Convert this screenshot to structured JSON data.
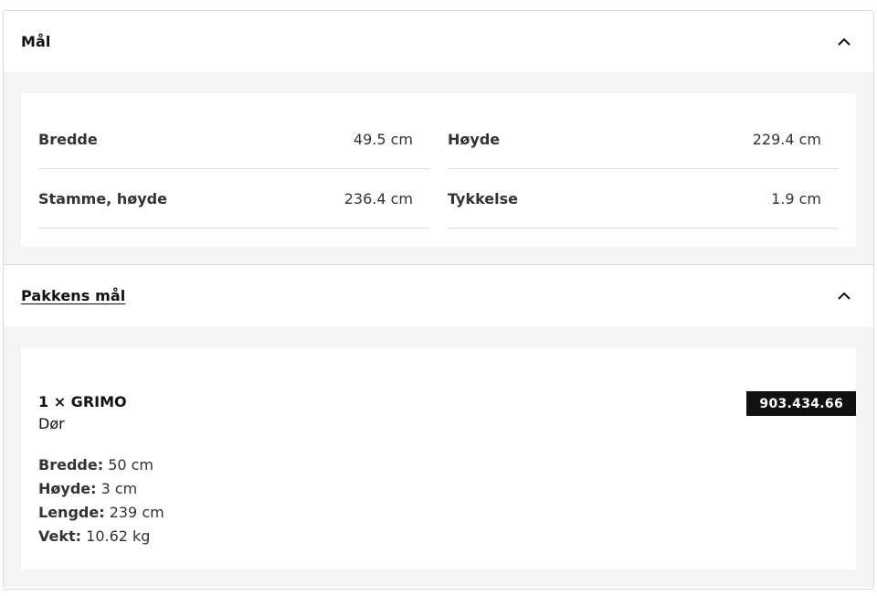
{
  "dimensions": {
    "title": "Mål",
    "rows_left": [
      {
        "label": "Bredde",
        "value": "49.5 cm"
      },
      {
        "label": "Stamme, høyde",
        "value": "236.4 cm"
      }
    ],
    "rows_right": [
      {
        "label": "Høyde",
        "value": "229.4 cm"
      },
      {
        "label": "Tykkelse",
        "value": "1.9 cm"
      }
    ]
  },
  "package": {
    "title": "Pakkens mål",
    "item_name": "1 × GRIMO",
    "item_type": "Dør",
    "article_number": "903.434.66",
    "specs": [
      {
        "label": "Bredde:",
        "value": "50 cm"
      },
      {
        "label": "Høyde:",
        "value": "3 cm"
      },
      {
        "label": "Lengde:",
        "value": "239 cm"
      },
      {
        "label": "Vekt:",
        "value": "10.62 kg"
      }
    ]
  },
  "icons": {
    "collapse": "chevron-up-icon"
  }
}
